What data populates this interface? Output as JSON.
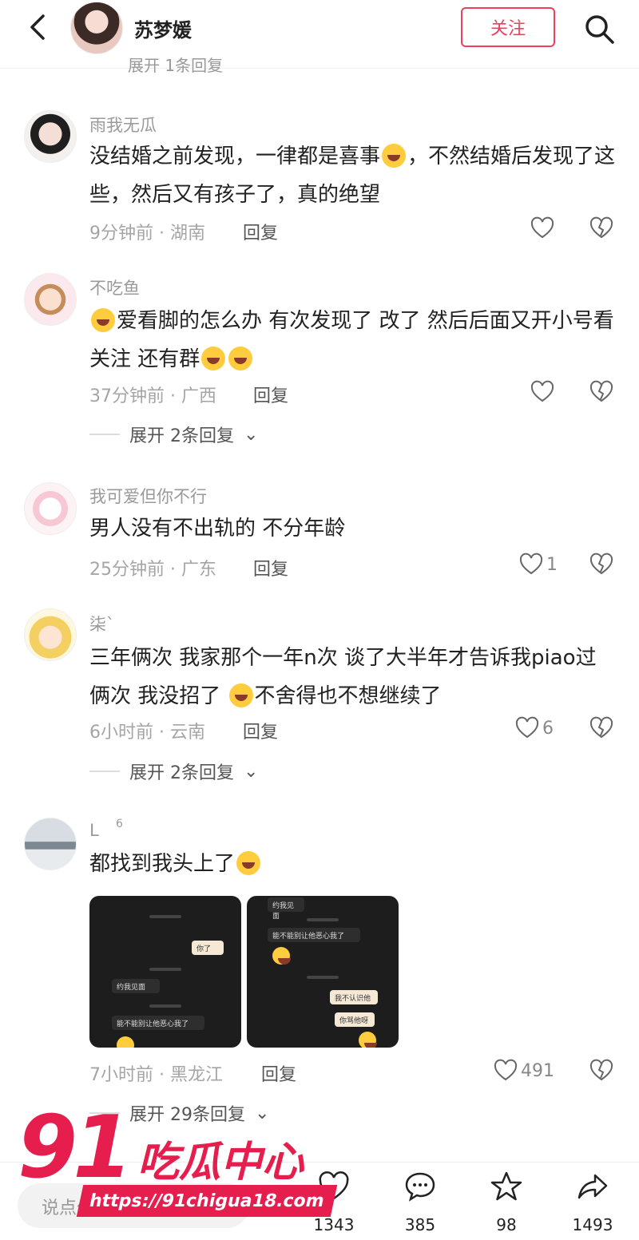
{
  "header": {
    "author": "苏梦媛",
    "follow_label": "关注",
    "clipped_text": "展开 1条回复"
  },
  "comments": [
    {
      "name": "雨我无瓜",
      "text_a": "没结婚之前发现，一律都是喜事",
      "text_b": "，不然结婚后发现了这些，然后又有孩子了，真的绝望",
      "meta": "9分钟前 · 湖南",
      "reply": "回复",
      "likes": ""
    },
    {
      "name": "不吃鱼",
      "text_a": "爱看脚的怎么办 有次发现了 改了 然后后面又开小号看 关注 还有群",
      "meta": "37分钟前 · 广西",
      "reply": "回复",
      "likes": "",
      "expand": "展开 2条回复"
    },
    {
      "name": "我可爱但你不行",
      "text_a": "男人没有不出轨的 不分年龄",
      "meta": "25分钟前 · 广东",
      "reply": "回复",
      "likes": "1"
    },
    {
      "name": "柒`",
      "text_a": "三年俩次 我家那个一年n次 谈了大半年才告诉我piao过俩次 我没招了",
      "text_b": "不舍得也不想继续了",
      "meta": "6小时前 · 云南",
      "reply": "回复",
      "likes": "6",
      "expand": "展开 2条回复"
    },
    {
      "name": "L",
      "badge": "6",
      "text_a": "都找到我头上了",
      "meta": "7小时前 · 黑龙江",
      "reply": "回复",
      "likes": "491",
      "expand": "展开 29条回复"
    }
  ],
  "screenshots": {
    "left": {
      "times": [
        "10:20",
        "10:43",
        "10:48"
      ],
      "bubbles": [
        "你了",
        "约我见面",
        "能不能别让他恶心我了"
      ]
    },
    "right": {
      "times": [
        "10:48",
        "10:50"
      ],
      "bubbles": [
        "约我见面",
        "能不能别让他恶心我了",
        "我不认识他",
        "你骂他呀"
      ]
    }
  },
  "bottom_bar": {
    "input_placeholder": "说点什么...",
    "likes": "1343",
    "comments": "385",
    "stars": "98",
    "shares": "1493"
  },
  "watermark": {
    "number": "91",
    "title": "吃瓜中心",
    "url": "https://91chigua18.com"
  },
  "colors": {
    "accent": "#ef3f5f",
    "watermark": "#e61e4d"
  }
}
